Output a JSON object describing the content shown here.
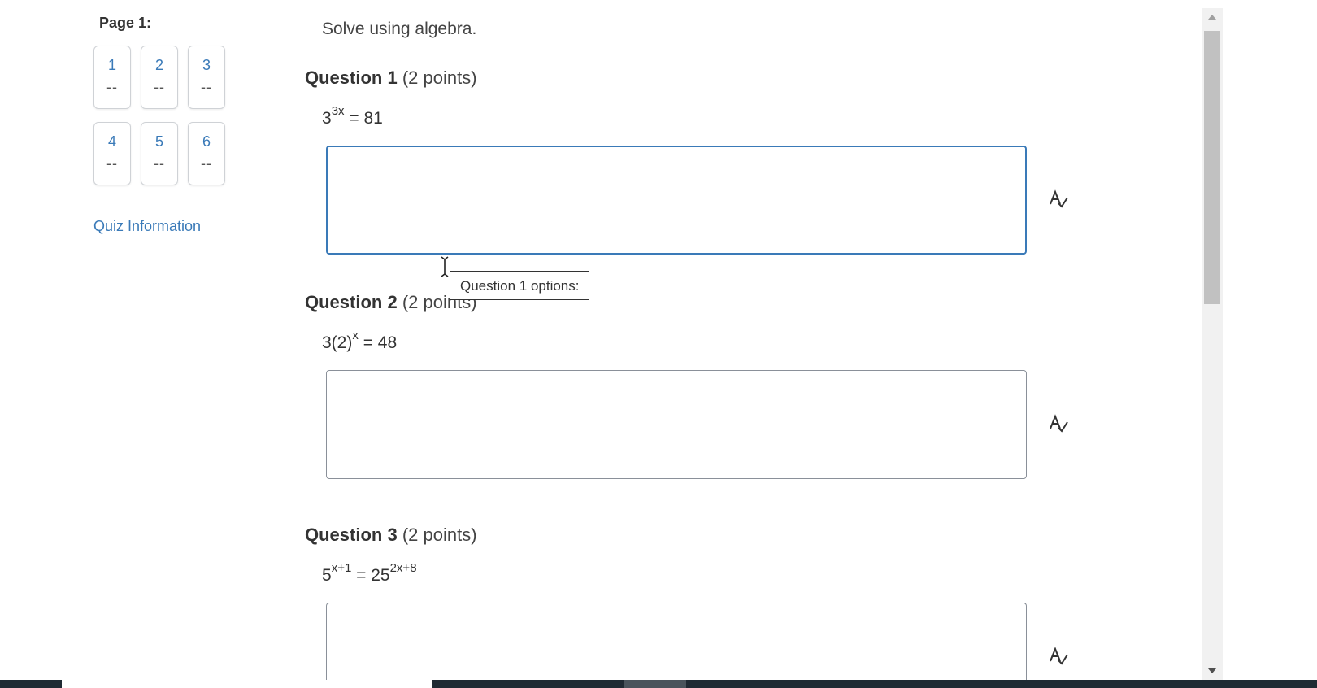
{
  "nav": {
    "page_label": "Page 1:",
    "questions": [
      {
        "number": "1",
        "status": "--"
      },
      {
        "number": "2",
        "status": "--"
      },
      {
        "number": "3",
        "status": "--"
      },
      {
        "number": "4",
        "status": "--"
      },
      {
        "number": "5",
        "status": "--"
      },
      {
        "number": "6",
        "status": "--"
      }
    ],
    "quiz_info_link": "Quiz Information"
  },
  "instructions": "Solve using algebra.",
  "questions": [
    {
      "title": "Question 1",
      "points": "(2 points)",
      "equation": {
        "base": "3",
        "exp": "3x",
        "rest": " = 81"
      }
    },
    {
      "title": "Question 2",
      "points": "(2 points)",
      "equation": {
        "base": "3(2)",
        "exp": "x",
        "rest": " = 48"
      }
    },
    {
      "title": "Question 3",
      "points": "(2 points)",
      "equation": {
        "base": "5",
        "exp": "x+1",
        "mid": " = 25",
        "exp2": "2x+8"
      }
    }
  ],
  "tooltip": "Question 1 options:",
  "icons": {
    "spell_check": "spell-check-icon",
    "scroll_up": "scroll-up-arrow-icon",
    "scroll_down": "scroll-down-arrow-icon",
    "cursor": "text-cursor-icon"
  },
  "colors": {
    "link": "#3a7ab8",
    "focus_border": "#3a7ab8",
    "box_border": "#8a9099"
  }
}
